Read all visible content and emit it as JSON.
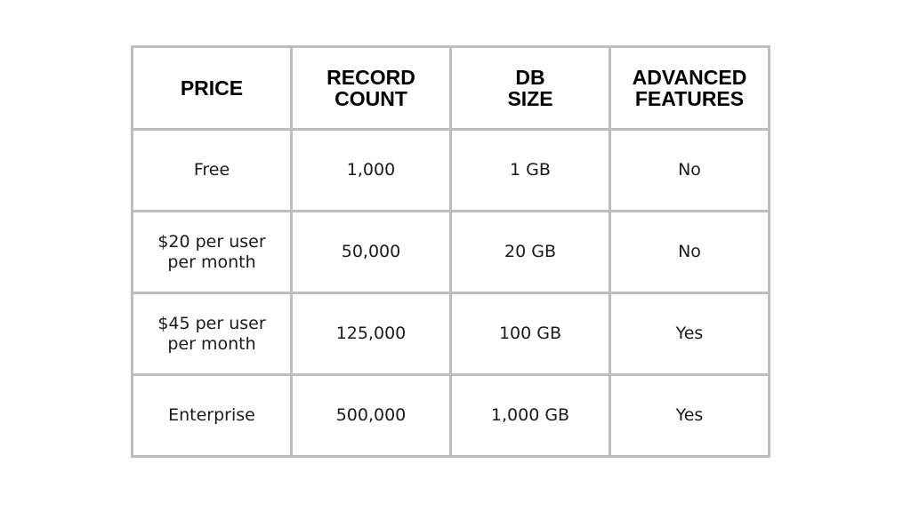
{
  "table": {
    "headers": [
      "PRICE",
      "RECORD\nCOUNT",
      "DB\nSIZE",
      "ADVANCED\nFEATURES"
    ],
    "header_lines": [
      [
        "PRICE"
      ],
      [
        "RECORD",
        "COUNT"
      ],
      [
        "DB",
        "SIZE"
      ],
      [
        "ADVANCED",
        "FEATURES"
      ]
    ],
    "rows": [
      {
        "price": [
          "Free"
        ],
        "record_count": "1,000",
        "db_size": "1 GB",
        "advanced_features": "No"
      },
      {
        "price": [
          "$20 per user",
          "per month"
        ],
        "record_count": "50,000",
        "db_size": "20 GB",
        "advanced_features": "No"
      },
      {
        "price": [
          "$45 per user",
          "per month"
        ],
        "record_count": "125,000",
        "db_size": "100 GB",
        "advanced_features": "Yes"
      },
      {
        "price": [
          "Enterprise"
        ],
        "record_count": "500,000",
        "db_size": "1,000 GB",
        "advanced_features": "Yes"
      }
    ]
  },
  "colors": {
    "border": "#bdbdbd",
    "text": "#1a1a1a",
    "background": "#ffffff"
  }
}
